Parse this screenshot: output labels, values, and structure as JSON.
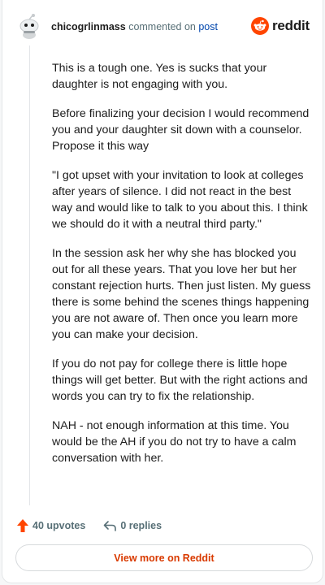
{
  "header": {
    "username": "chicogrlinmass",
    "action": "commented on",
    "post_link": "post",
    "logo_text": "reddit"
  },
  "comment": {
    "paragraphs": [
      "This is a tough one. Yes is sucks that your daughter is not engaging with you.",
      "Before finalizing your decision I would recommend you and your daughter sit down with a counselor. Propose it this way",
      "\"I got upset with your invitation to look at colleges after years of silence. I did not react in the best way and would like to talk to you about this. I think we should do it with a neutral third party.\"",
      "In the session ask her why she has blocked you out for all these years. That you love her but her constant rejection hurts. Then just listen. My guess there is some behind the scenes things happening you are not aware of. Then once you learn more you can make your decision.",
      "If you do not pay for college there is little hope things will get better. But with the right actions and words you can try to fix the relationship.",
      "NAH - not enough information at this time. You would be the AH if you do not try to have a calm conversation with her."
    ]
  },
  "actions": {
    "upvotes": "40 upvotes",
    "replies": "0 replies"
  },
  "footer": {
    "view_more": "View more on Reddit"
  },
  "colors": {
    "brand": "#ff4500",
    "link": "#0045ac",
    "muted": "#576f76",
    "cta": "#d93a00"
  },
  "icons": [
    "avatar-snoo",
    "reddit-logo-icon",
    "upvote-arrow-icon",
    "reply-arrow-icon"
  ]
}
